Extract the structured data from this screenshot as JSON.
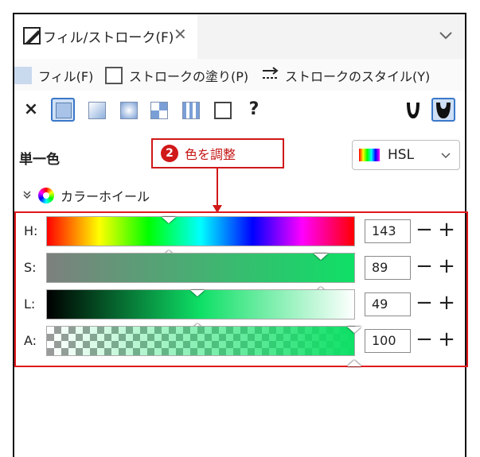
{
  "tab": {
    "title": "フィル/ストローク(F)",
    "close": "✕"
  },
  "modes": [
    {
      "label": "フィル(F)"
    },
    {
      "label": "ストロークの塗り(P)"
    },
    {
      "label": "ストロークのスタイル(Y)"
    }
  ],
  "paint_types": {
    "none": "×",
    "unknown": "?"
  },
  "fill_mode_label": "単一色",
  "annotation": {
    "number": "2",
    "text": "色を調整"
  },
  "color_mode": {
    "selected": "HSL"
  },
  "wheel_toggle": {
    "label": "カラーホイール"
  },
  "sliders": [
    {
      "label": "H:",
      "value": "143",
      "level": 0.397
    },
    {
      "label": "S:",
      "value": "89",
      "level": 0.89
    },
    {
      "label": "L:",
      "value": "49",
      "level": 0.49
    },
    {
      "label": "A:",
      "value": "100",
      "level": 1.0
    }
  ],
  "buttons": {
    "minus": "−",
    "plus": "+"
  },
  "colors": {
    "accent": "#e0181c",
    "current_color": "#0ee066",
    "selection": "#3a78c9"
  }
}
